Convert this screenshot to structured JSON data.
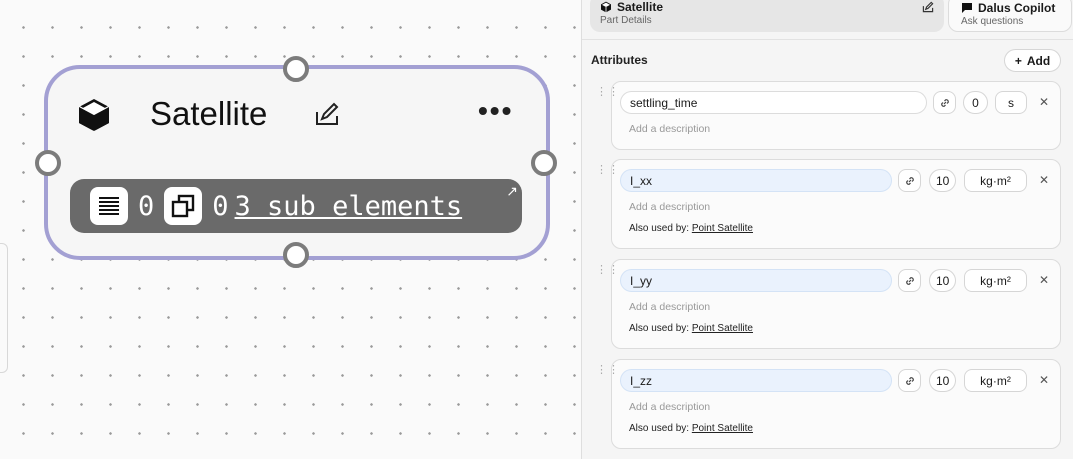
{
  "node": {
    "title": "Satellite",
    "requirements_count": "0",
    "instances_count": "0",
    "sub_elements_link": "3 sub elements",
    "more_label": "•••",
    "border_color": "#a3a0d3"
  },
  "tabs": {
    "active": {
      "title": "Satellite",
      "subtitle": "Part Details"
    },
    "inactive": {
      "title": "Dalus Copilot",
      "subtitle": "Ask questions"
    }
  },
  "attributes": {
    "heading": "Attributes",
    "add_label": "Add",
    "items": [
      {
        "name": "settling_time",
        "value": "0",
        "unit": "s",
        "description_placeholder": "Add a description",
        "used_by_label": "",
        "used_by_link": ""
      },
      {
        "name": "I_xx",
        "value": "10",
        "unit": "kg·m²",
        "description_placeholder": "Add a description",
        "used_by_label": "Also used by:",
        "used_by_link": "Point Satellite"
      },
      {
        "name": "I_yy",
        "value": "10",
        "unit": "kg·m²",
        "description_placeholder": "Add a description",
        "used_by_label": "Also used by:",
        "used_by_link": "Point Satellite"
      },
      {
        "name": "I_zz",
        "value": "10",
        "unit": "kg·m²",
        "description_placeholder": "Add a description",
        "used_by_label": "Also used by:",
        "used_by_link": "Point Satellite"
      }
    ]
  }
}
